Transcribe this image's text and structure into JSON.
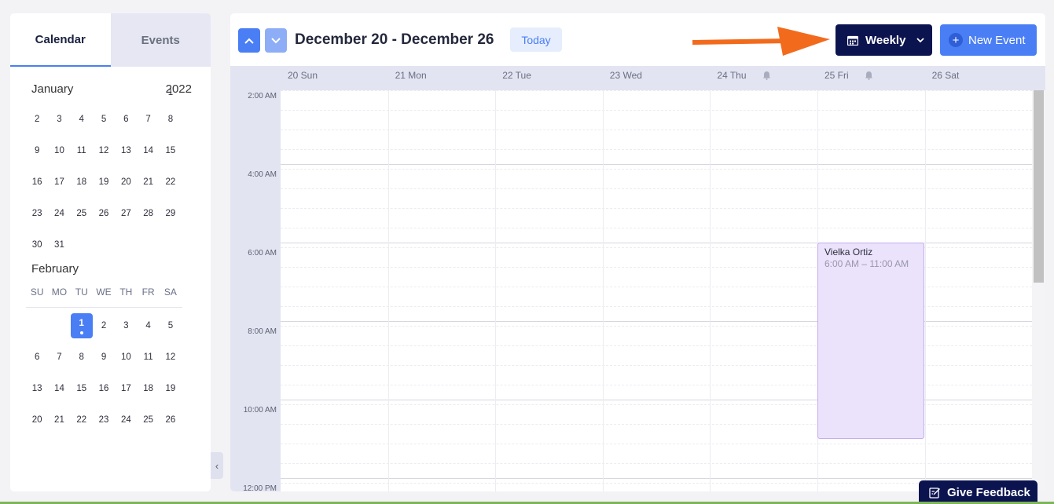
{
  "sidebar": {
    "tabs": [
      {
        "label": "Calendar"
      },
      {
        "label": "Events"
      }
    ],
    "january": {
      "name": "January",
      "year": "2022",
      "weeks": [
        [
          "",
          "",
          "",
          "",
          "",
          "",
          "1"
        ],
        [
          "2",
          "3",
          "4",
          "5",
          "6",
          "7",
          "8"
        ],
        [
          "9",
          "10",
          "11",
          "12",
          "13",
          "14",
          "15"
        ],
        [
          "16",
          "17",
          "18",
          "19",
          "20",
          "21",
          "22"
        ],
        [
          "23",
          "24",
          "25",
          "26",
          "27",
          "28",
          "29"
        ],
        [
          "30",
          "31",
          "",
          "",
          "",
          "",
          ""
        ]
      ]
    },
    "february": {
      "name": "February",
      "weekdays": [
        "SU",
        "MO",
        "TU",
        "WE",
        "TH",
        "FR",
        "SA"
      ],
      "weeks": [
        [
          "",
          "",
          "1",
          "2",
          "3",
          "4",
          "5"
        ],
        [
          "6",
          "7",
          "8",
          "9",
          "10",
          "11",
          "12"
        ],
        [
          "13",
          "14",
          "15",
          "16",
          "17",
          "18",
          "19"
        ],
        [
          "20",
          "21",
          "22",
          "23",
          "24",
          "25",
          "26"
        ]
      ],
      "selected_day": "1"
    }
  },
  "header": {
    "range_title": "December 20 - December 26",
    "today_label": "Today",
    "view_label": "Weekly",
    "new_event_label": "New Event"
  },
  "days": [
    {
      "label": "20 Sun",
      "bell": false
    },
    {
      "label": "21 Mon",
      "bell": false
    },
    {
      "label": "22 Tue",
      "bell": false
    },
    {
      "label": "23 Wed",
      "bell": false
    },
    {
      "label": "24 Thu",
      "bell": true
    },
    {
      "label": "25 Fri",
      "bell": true
    },
    {
      "label": "26 Sat",
      "bell": false
    }
  ],
  "times": [
    "2:00 AM",
    "4:00 AM",
    "6:00 AM",
    "8:00 AM",
    "10:00 AM",
    "12:00 PM"
  ],
  "event": {
    "name": "Vielka Ortiz",
    "time": "6:00 AM – 11:00 AM",
    "color": "#ebe2fb"
  },
  "feedback_label": "Give Feedback",
  "colors": {
    "primary": "#4a7ef5",
    "dark": "#0c1450",
    "arrow": "#f26b1d"
  }
}
